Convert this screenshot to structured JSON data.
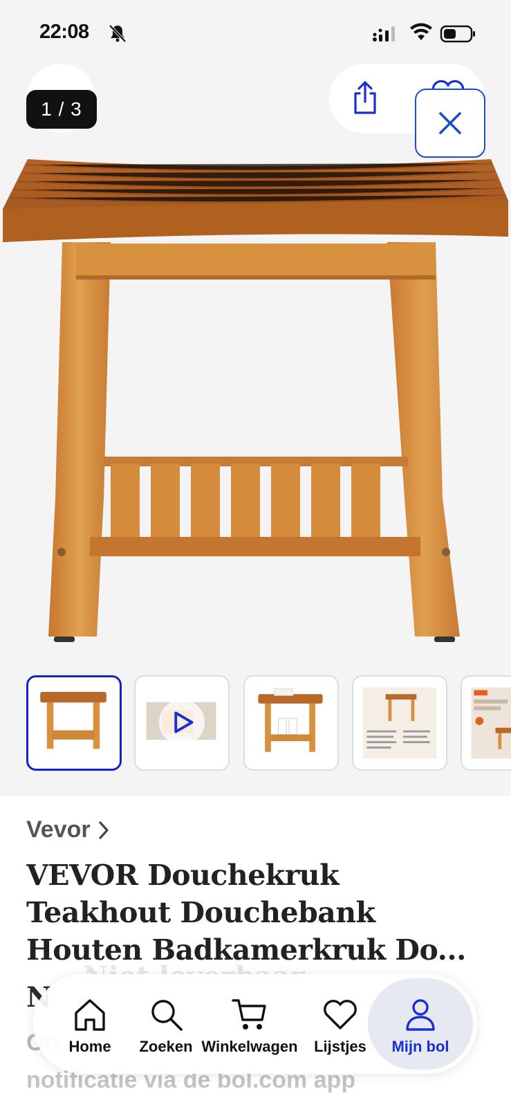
{
  "status_bar": {
    "time": "22:08"
  },
  "viewer": {
    "counter": "1 / 3"
  },
  "thumbnails": [
    {
      "name": "thumb-stool-front",
      "active": true
    },
    {
      "name": "thumb-video",
      "active": false
    },
    {
      "name": "thumb-stool-with-towels",
      "active": false
    },
    {
      "name": "thumb-dimensions",
      "active": false
    },
    {
      "name": "thumb-promo",
      "active": false
    }
  ],
  "product": {
    "brand": "Vevor",
    "title_lines": [
      "VEVOR Douchekruk",
      "Teakhout Douchebank",
      "Houten Badkamerkruk Do..."
    ]
  },
  "behind": {
    "first_letter": "N",
    "ghost": "Niet leverbaar",
    "line1": "On",
    "line2": "notificatie via de bol.com app"
  },
  "tabbar": {
    "tabs": [
      {
        "label": "Home",
        "icon": "home-icon"
      },
      {
        "label": "Zoeken",
        "icon": "search-icon"
      },
      {
        "label": "Winkelwagen",
        "icon": "cart-icon"
      },
      {
        "label": "Lijstjes",
        "icon": "heart-icon"
      },
      {
        "label": "Mijn bol",
        "icon": "user-icon",
        "active": true
      }
    ]
  },
  "colors": {
    "accent": "#1a20c8",
    "active_tab": "#1a2fd0",
    "wood": "#d48a3a"
  }
}
